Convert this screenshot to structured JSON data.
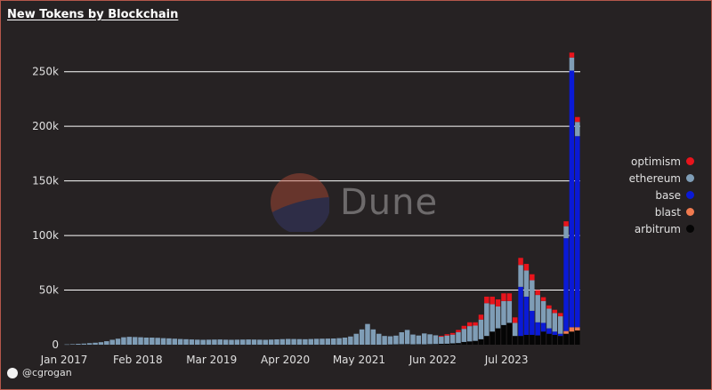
{
  "title": "New Tokens by Blockchain",
  "author": "@cgrogan",
  "watermark": "Dune",
  "colors": {
    "optimism": "#e8141c",
    "ethereum": "#7f9db6",
    "base": "#0a1ad6",
    "blast": "#f07a4f",
    "arbitrum": "#050505",
    "grid": "#ffffff",
    "background": "#262223"
  },
  "legend": [
    {
      "name": "optimism",
      "color": "#e8141c"
    },
    {
      "name": "ethereum",
      "color": "#7f9db6"
    },
    {
      "name": "base",
      "color": "#0a1ad6"
    },
    {
      "name": "blast",
      "color": "#f07a4f"
    },
    {
      "name": "arbitrum",
      "color": "#050505"
    }
  ],
  "chart_data": {
    "type": "bar",
    "stacked": true,
    "title": "New Tokens by Blockchain",
    "xlabel": "",
    "ylabel": "",
    "ylim": [
      0,
      275000
    ],
    "yticks": [
      0,
      50000,
      100000,
      150000,
      200000,
      250000
    ],
    "ytick_labels": [
      "0",
      "50k",
      "100k",
      "150k",
      "200k",
      "250k"
    ],
    "xtick_labels": [
      "Jan 2017",
      "Feb 2018",
      "Mar 2019",
      "Apr 2020",
      "May 2021",
      "Jun 2022",
      "Jul 2023"
    ],
    "xtick_positions": [
      0,
      13,
      26,
      39,
      52,
      65,
      78
    ],
    "grid": true,
    "legend_position": "right",
    "x": [
      "2017-01",
      "2017-02",
      "2017-03",
      "2017-04",
      "2017-05",
      "2017-06",
      "2017-07",
      "2017-08",
      "2017-09",
      "2017-10",
      "2017-11",
      "2017-12",
      "2018-01",
      "2018-02",
      "2018-03",
      "2018-04",
      "2018-05",
      "2018-06",
      "2018-07",
      "2018-08",
      "2018-09",
      "2018-10",
      "2018-11",
      "2018-12",
      "2019-01",
      "2019-02",
      "2019-03",
      "2019-04",
      "2019-05",
      "2019-06",
      "2019-07",
      "2019-08",
      "2019-09",
      "2019-10",
      "2019-11",
      "2019-12",
      "2020-01",
      "2020-02",
      "2020-03",
      "2020-04",
      "2020-05",
      "2020-06",
      "2020-07",
      "2020-08",
      "2020-09",
      "2020-10",
      "2020-11",
      "2020-12",
      "2021-01",
      "2021-02",
      "2021-03",
      "2021-04",
      "2021-05",
      "2021-06",
      "2021-07",
      "2021-08",
      "2021-09",
      "2021-10",
      "2021-11",
      "2021-12",
      "2022-01",
      "2022-02",
      "2022-03",
      "2022-04",
      "2022-05",
      "2022-06",
      "2022-07",
      "2022-08",
      "2022-09",
      "2022-10",
      "2022-11",
      "2022-12",
      "2023-01",
      "2023-02",
      "2023-03",
      "2023-04",
      "2023-05",
      "2023-06",
      "2023-07",
      "2023-08",
      "2023-09",
      "2023-10",
      "2023-11",
      "2023-12",
      "2024-01",
      "2024-02",
      "2024-03",
      "2024-04",
      "2024-05",
      "2024-06",
      "2024-07"
    ],
    "series": [
      {
        "name": "arbitrum",
        "values": [
          0,
          0,
          0,
          0,
          0,
          0,
          0,
          0,
          0,
          0,
          0,
          0,
          0,
          0,
          0,
          0,
          0,
          0,
          0,
          0,
          0,
          0,
          0,
          0,
          0,
          0,
          0,
          0,
          0,
          0,
          0,
          0,
          0,
          0,
          0,
          0,
          0,
          0,
          0,
          0,
          0,
          0,
          0,
          0,
          0,
          0,
          0,
          0,
          0,
          0,
          0,
          0,
          0,
          0,
          0,
          0,
          0,
          200,
          300,
          400,
          500,
          300,
          400,
          300,
          500,
          600,
          800,
          900,
          1200,
          1500,
          2500,
          3000,
          3500,
          5000,
          8000,
          12000,
          15000,
          18000,
          20000,
          8000,
          8000,
          9000,
          9000,
          8500,
          12000,
          10000,
          9000,
          8000,
          10000,
          12000,
          13000,
          12000,
          13000,
          14000,
          3000
        ]
      },
      {
        "name": "blast",
        "values": [
          0,
          0,
          0,
          0,
          0,
          0,
          0,
          0,
          0,
          0,
          0,
          0,
          0,
          0,
          0,
          0,
          0,
          0,
          0,
          0,
          0,
          0,
          0,
          0,
          0,
          0,
          0,
          0,
          0,
          0,
          0,
          0,
          0,
          0,
          0,
          0,
          0,
          0,
          0,
          0,
          0,
          0,
          0,
          0,
          0,
          0,
          0,
          0,
          0,
          0,
          0,
          0,
          0,
          0,
          0,
          0,
          0,
          0,
          0,
          0,
          0,
          0,
          0,
          0,
          0,
          0,
          0,
          0,
          0,
          0,
          0,
          0,
          0,
          0,
          0,
          0,
          0,
          0,
          0,
          0,
          0,
          0,
          0,
          0,
          0,
          0,
          0,
          0,
          2500,
          4000,
          3000,
          3000,
          2000,
          1500,
          0
        ]
      },
      {
        "name": "base",
        "values": [
          0,
          0,
          0,
          0,
          0,
          0,
          0,
          0,
          0,
          0,
          0,
          0,
          0,
          0,
          0,
          0,
          0,
          0,
          0,
          0,
          0,
          0,
          0,
          0,
          0,
          0,
          0,
          0,
          0,
          0,
          0,
          0,
          0,
          0,
          0,
          0,
          0,
          0,
          0,
          0,
          0,
          0,
          0,
          0,
          0,
          0,
          0,
          0,
          0,
          0,
          0,
          0,
          0,
          0,
          0,
          0,
          0,
          0,
          0,
          0,
          0,
          0,
          0,
          0,
          0,
          0,
          0,
          0,
          0,
          0,
          0,
          0,
          0,
          0,
          0,
          0,
          0,
          0,
          0,
          0,
          45000,
          35000,
          22000,
          12000,
          8000,
          5000,
          3000,
          2000,
          85000,
          235000,
          175000,
          0,
          0,
          0,
          0
        ]
      },
      {
        "name": "ethereum",
        "values": [
          300,
          500,
          800,
          1000,
          1400,
          1800,
          2300,
          3200,
          4500,
          5500,
          6800,
          7200,
          7000,
          6800,
          6500,
          6500,
          6300,
          6000,
          5800,
          5500,
          5200,
          5000,
          4800,
          4600,
          4500,
          4600,
          4700,
          4800,
          4600,
          4500,
          4600,
          4700,
          4800,
          4700,
          4600,
          4500,
          4700,
          4900,
          5100,
          5300,
          5200,
          5100,
          5000,
          5200,
          5400,
          5500,
          5600,
          5700,
          6000,
          6500,
          7500,
          10000,
          14000,
          19000,
          14000,
          10000,
          8000,
          7500,
          8000,
          11000,
          13000,
          9000,
          8000,
          10000,
          9000,
          8000,
          6500,
          7500,
          8000,
          10000,
          12000,
          14000,
          14000,
          18000,
          30000,
          25000,
          20000,
          22000,
          20000,
          12000,
          20000,
          24000,
          28000,
          25000,
          20000,
          18000,
          17000,
          16000,
          11000,
          12000,
          13000,
          0,
          0,
          0,
          24000
        ]
      },
      {
        "name": "optimism",
        "values": [
          0,
          0,
          0,
          0,
          0,
          0,
          0,
          0,
          0,
          0,
          0,
          0,
          0,
          0,
          0,
          0,
          0,
          0,
          0,
          0,
          0,
          0,
          0,
          0,
          0,
          0,
          0,
          0,
          0,
          0,
          0,
          0,
          0,
          0,
          0,
          0,
          0,
          0,
          0,
          0,
          0,
          0,
          0,
          0,
          0,
          0,
          0,
          0,
          0,
          0,
          0,
          0,
          0,
          0,
          0,
          0,
          0,
          0,
          0,
          0,
          0,
          0,
          0,
          0,
          0,
          0,
          800,
          1200,
          1500,
          2000,
          2800,
          3500,
          3000,
          4500,
          6000,
          7000,
          6500,
          7000,
          7000,
          5000,
          6500,
          6000,
          5500,
          4500,
          3500,
          3000,
          3000,
          3000,
          4500,
          4500,
          4500,
          0,
          0,
          0,
          1500
        ]
      }
    ]
  }
}
